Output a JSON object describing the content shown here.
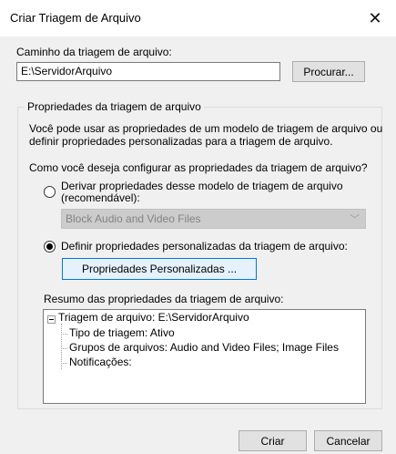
{
  "window": {
    "title": "Criar Triagem de Arquivo",
    "close_glyph": "✕"
  },
  "path": {
    "label": "Caminho da triagem de arquivo:",
    "value": "E:\\ServidorArquivo",
    "browse_button": "Procurar..."
  },
  "properties_group": {
    "title": "Propriedades da triagem de arquivo",
    "description_line1": "Você pode usar as propriedades de um modelo de triagem de arquivo ou",
    "description_line2": "definir propriedades personalizadas para a triagem de arquivo.",
    "question": "Como você deseja configurar as propriedades da triagem de arquivo?",
    "option_derive": {
      "label_line1": "Derivar propriedades desse modelo de triagem de arquivo",
      "label_line2": "(recomendável):",
      "selected": false
    },
    "template_select": {
      "value": "Block Audio and Video Files",
      "enabled": false
    },
    "option_custom": {
      "label": "Definir propriedades personalizadas da triagem de arquivo:",
      "selected": true
    },
    "custom_properties_button": "Propriedades Personalizadas ...",
    "summary_label": "Resumo das propriedades da triagem de arquivo:",
    "summary_tree": {
      "root": "Triagem de arquivo: E:\\ServidorArquivo",
      "children": [
        "Tipo de triagem: Ativo",
        "Grupos de arquivos: Audio and Video Files; Image Files",
        "Notificações:"
      ]
    }
  },
  "footer": {
    "create_button": "Criar",
    "cancel_button": "Cancelar"
  }
}
